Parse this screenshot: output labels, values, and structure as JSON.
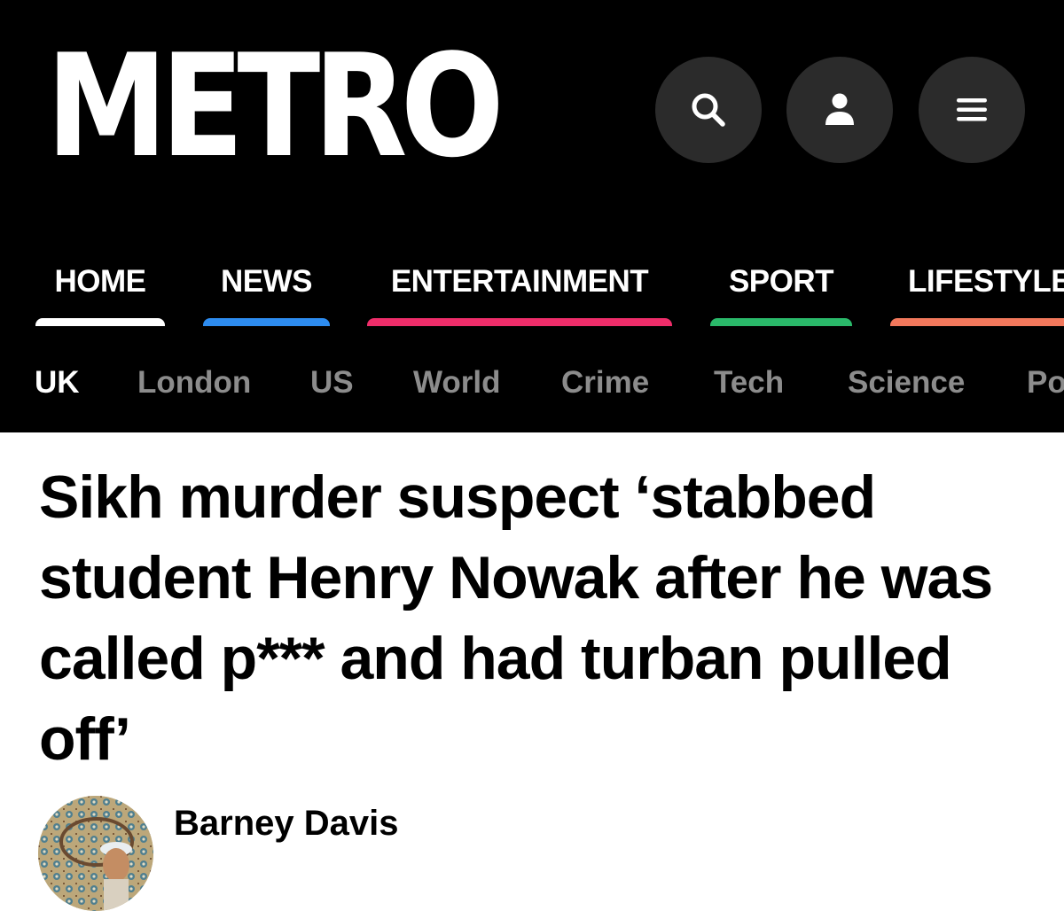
{
  "header": {
    "logo_text": "METRO",
    "background_color": "#000000",
    "icon_buttons": [
      {
        "icon": "search-icon"
      },
      {
        "icon": "user-icon"
      },
      {
        "icon": "menu-icon"
      }
    ]
  },
  "main_nav": [
    {
      "label": "HOME",
      "accent_color": "#ffffff",
      "active": true
    },
    {
      "label": "NEWS",
      "accent_color": "#2d8cf0"
    },
    {
      "label": "ENTERTAINMENT",
      "accent_color": "#ef2d6a"
    },
    {
      "label": "SPORT",
      "accent_color": "#2ab96a"
    },
    {
      "label": "LIFESTYLE",
      "accent_color": "#f2785c"
    }
  ],
  "sub_nav": {
    "active_color": "#ffffff",
    "inactive_color": "#8c8c8c",
    "items": [
      {
        "label": "UK",
        "active": true
      },
      {
        "label": "London"
      },
      {
        "label": "US"
      },
      {
        "label": "World"
      },
      {
        "label": "Crime"
      },
      {
        "label": "Tech"
      },
      {
        "label": "Science"
      },
      {
        "label": "Po"
      }
    ]
  },
  "article": {
    "headline": "Sikh murder suspect ‘stabbed student Henry Nowak after he was called p*** and had turban pulled off’",
    "author": "Barney Davis"
  }
}
